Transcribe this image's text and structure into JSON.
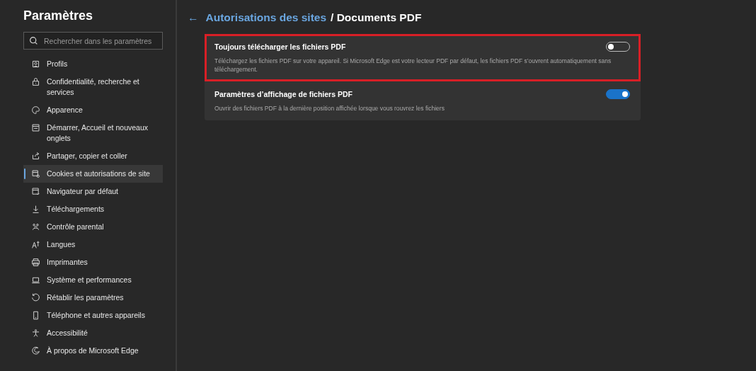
{
  "sidebar": {
    "title": "Paramètres",
    "search": {
      "placeholder": "Rechercher dans les paramètres"
    },
    "items": [
      {
        "label": "Profils",
        "selected": false
      },
      {
        "label": "Confidentialité, recherche et services",
        "selected": false
      },
      {
        "label": "Apparence",
        "selected": false
      },
      {
        "label": "Démarrer, Accueil et nouveaux onglets",
        "selected": false
      },
      {
        "label": "Partager, copier et coller",
        "selected": false
      },
      {
        "label": "Cookies et autorisations de site",
        "selected": true
      },
      {
        "label": "Navigateur par défaut",
        "selected": false
      },
      {
        "label": "Téléchargements",
        "selected": false
      },
      {
        "label": "Contrôle parental",
        "selected": false
      },
      {
        "label": "Langues",
        "selected": false
      },
      {
        "label": "Imprimantes",
        "selected": false
      },
      {
        "label": "Système et performances",
        "selected": false
      },
      {
        "label": "Rétablir les paramètres",
        "selected": false
      },
      {
        "label": "Téléphone et autres appareils",
        "selected": false
      },
      {
        "label": "Accessibilité",
        "selected": false
      },
      {
        "label": "À propos de Microsoft Edge",
        "selected": false
      }
    ]
  },
  "header": {
    "back": "←",
    "link": "Autorisations des sites",
    "current": "/ Documents PDF"
  },
  "settings": [
    {
      "title": "Toujours télécharger les fichiers PDF",
      "description": "Téléchargez les fichiers PDF sur votre appareil. Si Microsoft Edge est votre lecteur PDF par défaut, les fichiers PDF s’ouvrent automatiquement sans téléchargement.",
      "on": false,
      "highlighted": true
    },
    {
      "title": "Paramètres d’affichage de fichiers PDF",
      "description": "Ouvrir des fichiers PDF à la dernière position affichée lorsque vous rouvrez les fichiers",
      "on": true,
      "highlighted": false
    }
  ]
}
